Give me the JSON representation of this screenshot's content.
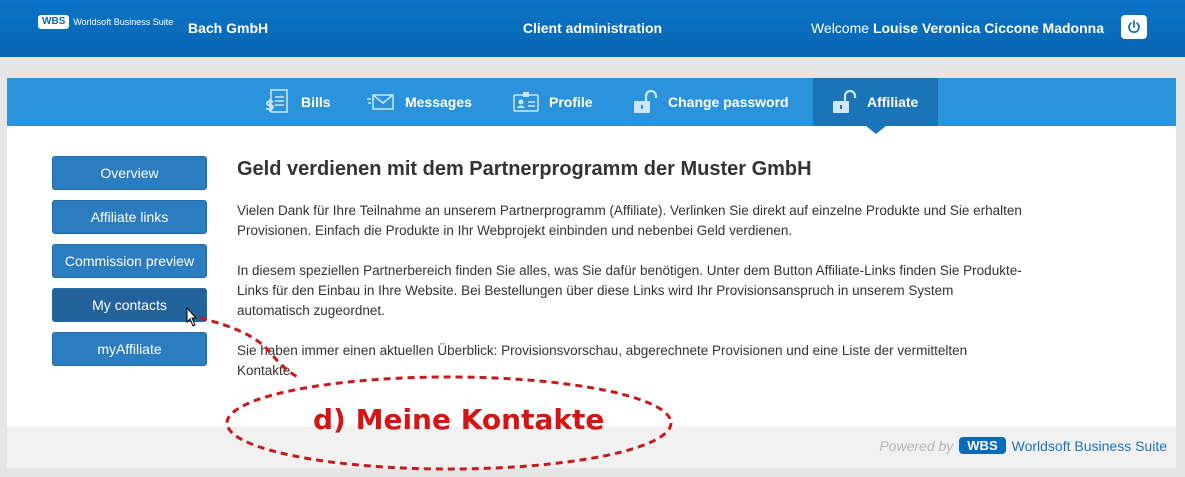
{
  "header": {
    "logo_box": "WBS",
    "logo_text": "Worldsoft Business Suite",
    "company": "Bach GmbH",
    "title": "Client administration",
    "welcome_prefix": "Welcome ",
    "user_name": "Louise Veronica Ciccone Madonna"
  },
  "tabs": [
    {
      "label": "Bills",
      "icon": "bill-icon"
    },
    {
      "label": "Messages",
      "icon": "envelope-icon"
    },
    {
      "label": "Profile",
      "icon": "id-card-icon"
    },
    {
      "label": "Change password",
      "icon": "unlock-icon"
    },
    {
      "label": "Affiliate",
      "icon": "unlock-icon",
      "active": true
    }
  ],
  "sidebar": [
    {
      "label": "Overview"
    },
    {
      "label": "Affiliate links"
    },
    {
      "label": "Commission preview"
    },
    {
      "label": "My contacts",
      "hovered": true
    },
    {
      "label": "myAffiliate"
    }
  ],
  "main": {
    "heading": "Geld verdienen mit dem Partnerprogramm der Muster GmbH",
    "paragraphs": [
      "Vielen Dank für Ihre Teilnahme an unserem Partnerprogramm (Affiliate). Verlinken Sie direkt auf einzelne Produkte und Sie erhalten Provisionen. Einfach die Produkte in Ihr Webprojekt einbinden und nebenbei Geld verdienen.",
      "In diesem speziellen Partnerbereich finden Sie alles, was Sie dafür benötigen. Unter dem Button Affiliate-Links finden Sie Produkte-Links für den Einbau in Ihre Website. Bei Bestellungen über diese Links wird Ihr Provisionsanspruch in unserem System automatisch zugeordnet.",
      "Sie haben immer einen aktuellen Überblick: Provisionsvorschau, abgerechnete Provisionen und eine Liste der vermittelten Kontakte."
    ]
  },
  "footer": {
    "powered_by": "Powered by",
    "wbs": "WBS",
    "suite": "Worldsoft Business Suite"
  },
  "annotation": {
    "label": "d) Meine Kontakte",
    "color": "#d21515"
  },
  "colors": {
    "header_blue": "#0a6ab8",
    "tab_blue": "#2b93dc",
    "button_blue": "#2c7dc0"
  }
}
